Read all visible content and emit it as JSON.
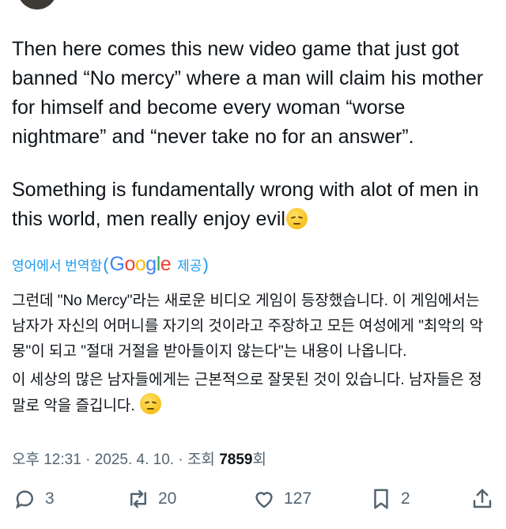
{
  "tweet": {
    "paragraph1": "Then here comes this new video game that just got banned “No mercy” where a man will claim his mother for himself and become every woman “worse nightmare” and “never take no for an answer”.",
    "paragraph2": "Something is fundamentally wrong with alot of men in this world, men really enjoy evil",
    "emoji": "pensive-face-emoji"
  },
  "translation": {
    "label": "영어에서 번역함",
    "provider": "Google",
    "provided": "제공",
    "paragraph1": "그런데 \"No Mercy\"라는 새로운 비디오 게임이 등장했습니다. 이 게임에서는 남자가 자신의 어머니를 자기의 것이라고 주장하고 모든 여성에게 \"최악의 악몽\"이 되고 \"절대 거절을 받아들이지 않는다\"는 내용이 나옵니다.",
    "paragraph2": "이 세상의 많은 남자들에게는 근본적으로 잘못된 것이 있습니다. 남자들은 정말로 악을 즐깁니다."
  },
  "meta": {
    "time": "오후 12:31",
    "date": "2025. 4. 10.",
    "views_prefix": "조회",
    "views_count": "7859",
    "views_suffix": "회"
  },
  "actions": {
    "replies": "3",
    "retweets": "20",
    "likes": "127",
    "bookmarks": "2"
  },
  "colors": {
    "text": "#0f1419",
    "muted": "#536471",
    "link": "#1d9bf0"
  }
}
